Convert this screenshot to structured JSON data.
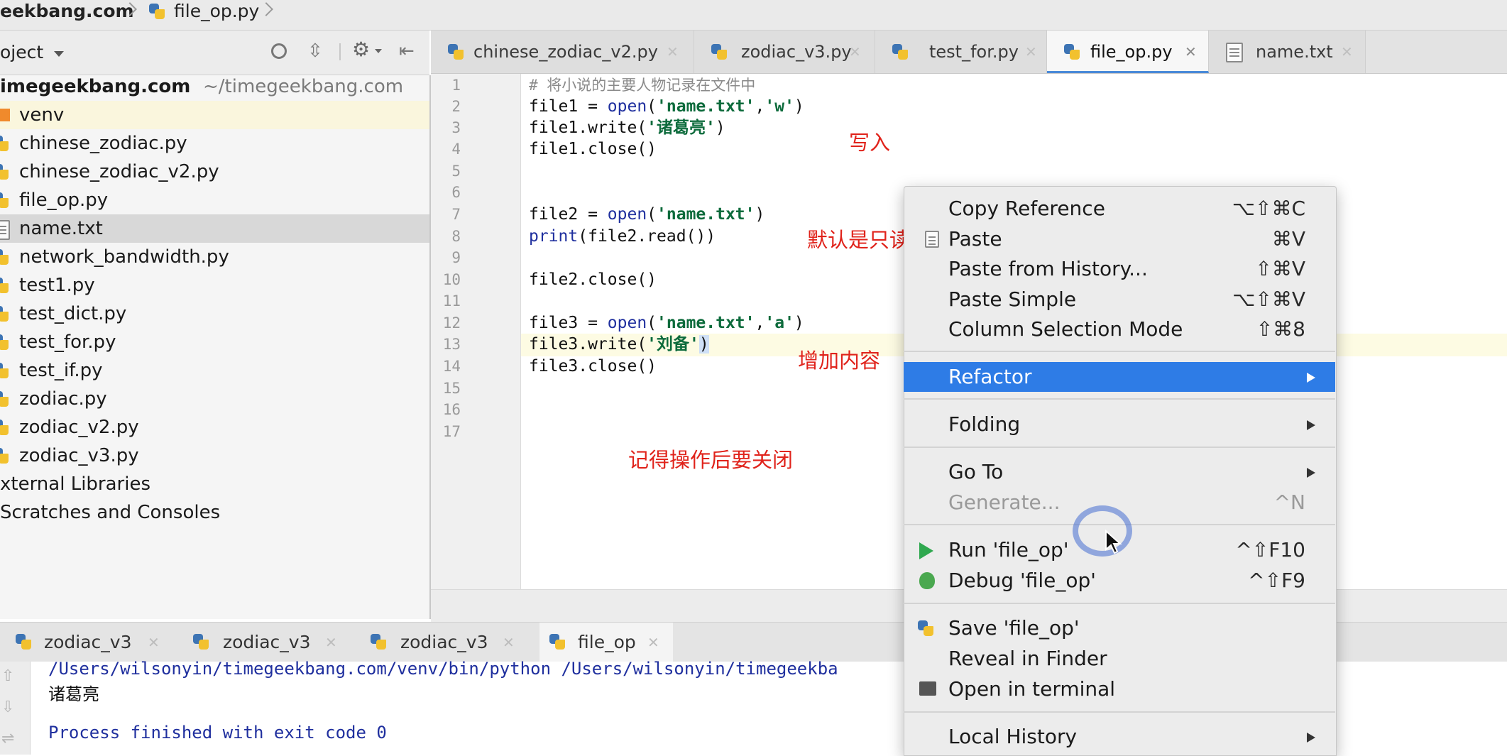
{
  "breadcrumb": {
    "project": "eekbang.com",
    "file": "file_op.py"
  },
  "project_panel": {
    "title": "oject",
    "root": {
      "name": "imegeekbang.com",
      "path": "~/timegeekbang.com"
    },
    "items": [
      {
        "label": "venv",
        "type": "folder"
      },
      {
        "label": "chinese_zodiac.py",
        "type": "py"
      },
      {
        "label": "chinese_zodiac_v2.py",
        "type": "py"
      },
      {
        "label": "file_op.py",
        "type": "py"
      },
      {
        "label": "name.txt",
        "type": "txt",
        "selected": true
      },
      {
        "label": "network_bandwidth.py",
        "type": "py"
      },
      {
        "label": "test1.py",
        "type": "py"
      },
      {
        "label": "test_dict.py",
        "type": "py"
      },
      {
        "label": "test_for.py",
        "type": "py"
      },
      {
        "label": "test_if.py",
        "type": "py"
      },
      {
        "label": "zodiac.py",
        "type": "py"
      },
      {
        "label": "zodiac_v2.py",
        "type": "py"
      },
      {
        "label": "zodiac_v3.py",
        "type": "py"
      },
      {
        "label": "xternal Libraries",
        "type": "lib"
      },
      {
        "label": "Scratches and Consoles",
        "type": "scratch"
      }
    ]
  },
  "editor_tabs": [
    {
      "label": "chinese_zodiac_v2.py",
      "active": false
    },
    {
      "label": "zodiac_v3.py",
      "active": false
    },
    {
      "label": "test_for.py",
      "active": false
    },
    {
      "label": "file_op.py",
      "active": true
    },
    {
      "label": "name.txt",
      "active": false
    }
  ],
  "code_lines": [
    "1",
    "2",
    "3",
    "4",
    "5",
    "6",
    "7",
    "8",
    "9",
    "10",
    "11",
    "12",
    "13",
    "14",
    "15",
    "16",
    "17"
  ],
  "code": {
    "l1": "# 将小说的主要人物记录在文件中",
    "l2a": "file1 = ",
    "l2b": "open",
    "l2c": "(",
    "l2d": "'name.txt'",
    "l2e": ",",
    "l2f": "'w'",
    "l2g": ")",
    "l3a": "file1.write(",
    "l3b": "'诸葛亮'",
    "l3c": ")",
    "l4": "file1.close()",
    "l7a": "file2 = ",
    "l7b": "open",
    "l7c": "(",
    "l7d": "'name.txt'",
    "l7e": ")",
    "l8a": "print",
    "l8b": "(file2.read())",
    "l10": "file2.close()",
    "l12a": "file3 = ",
    "l12b": "open",
    "l12c": "(",
    "l12d": "'name.txt'",
    "l12e": ",",
    "l12f": "'a'",
    "l12g": ")",
    "l13a": "file3.write(",
    "l13b": "'刘备'",
    "l13c": ")",
    "l14": "file3.close()"
  },
  "annotations": {
    "write": "写入",
    "readonly": "默认是只读",
    "append": "增加内容",
    "close_note": "记得操作后要关闭"
  },
  "run_tabs": [
    {
      "label": "zodiac_v3",
      "active": false
    },
    {
      "label": "zodiac_v3",
      "active": false
    },
    {
      "label": "zodiac_v3",
      "active": false
    },
    {
      "label": "file_op",
      "active": true
    }
  ],
  "run_output": {
    "command": "/Users/wilsonyin/timegeekbang.com/venv/bin/python /Users/wilsonyin/timegeekba",
    "line1": "诸葛亮",
    "exit": "Process finished with exit code 0"
  },
  "context_menu": {
    "copy_reference": {
      "label": "Copy Reference",
      "shortcut": "⌥⇧⌘C"
    },
    "paste": {
      "label": "Paste",
      "shortcut": "⌘V"
    },
    "paste_history": {
      "label": "Paste from History...",
      "shortcut": "⇧⌘V"
    },
    "paste_simple": {
      "label": "Paste Simple",
      "shortcut": "⌥⇧⌘V"
    },
    "column_selection": {
      "label": "Column Selection Mode",
      "shortcut": "⇧⌘8"
    },
    "refactor": {
      "label": "Refactor"
    },
    "folding": {
      "label": "Folding"
    },
    "go_to": {
      "label": "Go To"
    },
    "generate": {
      "label": "Generate...",
      "shortcut": "^N"
    },
    "run": {
      "label": "Run 'file_op'",
      "shortcut": "^⇧F10"
    },
    "debug": {
      "label": "Debug 'file_op'",
      "shortcut": "^⇧F9"
    },
    "save": {
      "label": "Save 'file_op'"
    },
    "reveal": {
      "label": "Reveal in Finder"
    },
    "terminal": {
      "label": "Open in terminal"
    },
    "local_history": {
      "label": "Local History"
    }
  },
  "colors": {
    "selection": "#2e7ce6",
    "annotation_red": "#e0231b",
    "string_green": "#0d6b3c"
  }
}
